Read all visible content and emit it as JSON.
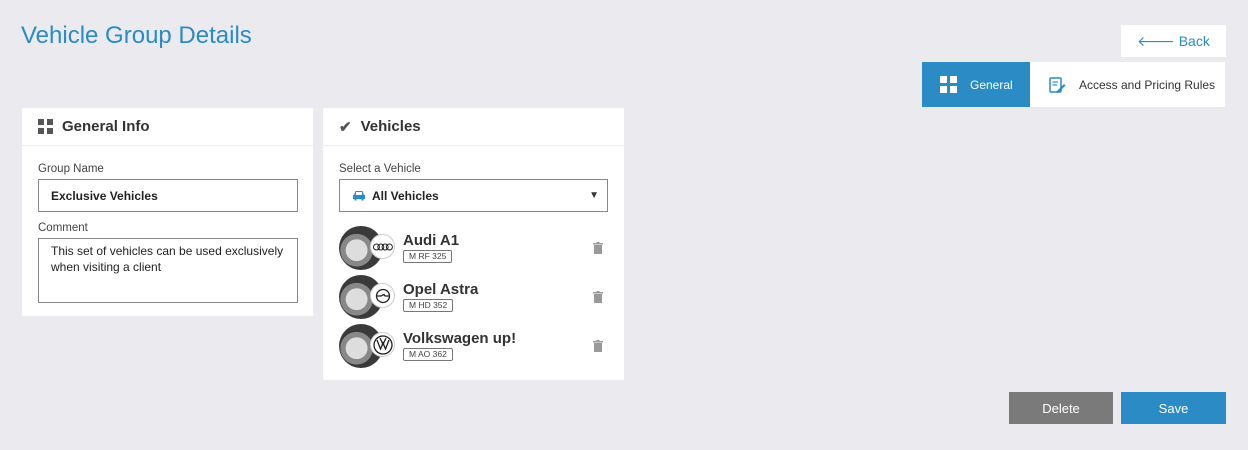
{
  "header": {
    "title": "Vehicle Group Details",
    "back_label": "Back"
  },
  "tabs": [
    {
      "label": "General",
      "active": true,
      "icon": "grid-icon"
    },
    {
      "label": "Access and Pricing Rules",
      "active": false,
      "icon": "edit-document-icon"
    }
  ],
  "general_info": {
    "title": "General Info",
    "group_name_label": "Group Name",
    "group_name_value": "Exclusive Vehicles",
    "comment_label": "Comment",
    "comment_value": "This set of vehicles can be used exclusively when visiting a client"
  },
  "vehicles": {
    "title": "Vehicles",
    "select_label": "Select a Vehicle",
    "select_value": "All Vehicles",
    "items": [
      {
        "name": "Audi A1",
        "plate": "M RF 325",
        "brand_icon": "audi-logo-icon"
      },
      {
        "name": "Opel Astra",
        "plate": "M HD 352",
        "brand_icon": "opel-logo-icon"
      },
      {
        "name": "Volkswagen up!",
        "plate": "M AO 362",
        "brand_icon": "volkswagen-logo-icon"
      }
    ]
  },
  "actions": {
    "delete_label": "Delete",
    "save_label": "Save"
  },
  "colors": {
    "accent": "#2a8bc5",
    "delete": "#7a7a7a",
    "background": "#ebebef"
  }
}
